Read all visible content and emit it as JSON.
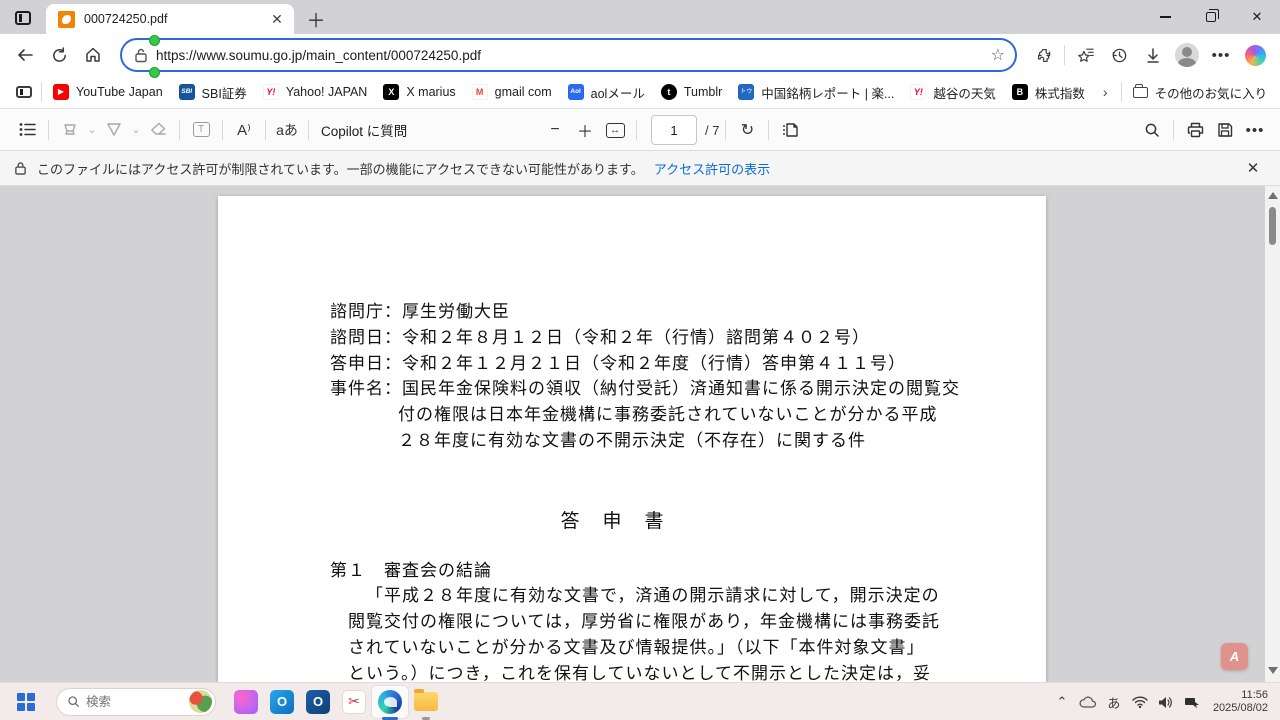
{
  "window": {
    "tab_title": "000724250.pdf"
  },
  "icons": {
    "close": "✕",
    "plus": "＋",
    "minus": "−",
    "back": "←",
    "star": "☆",
    "more_dots": "•••",
    "ellipsis": "…",
    "chevron_down": "⌄",
    "chevron_right": "›",
    "caret_up": "⌃",
    "fit_arrows": "↔",
    "rotate": "↻",
    "read_aloud": "A⁾",
    "translate": "aあ",
    "text_box": "T",
    "ime_mode": "あ",
    "play": "▶",
    "scissors": "✂",
    "acrobat": "A",
    "outlook_o": "O"
  },
  "address_bar": {
    "url": "https://www.soumu.go.jp/main_content/000724250.pdf"
  },
  "bookmarks": {
    "items": [
      {
        "label": "YouTube Japan",
        "glyph": "▶",
        "icon_style": "background:#f00;color:#fff;font-size:8px"
      },
      {
        "label": "SBI証券",
        "glyph": "SBI",
        "icon_style": "background:#16549c;color:#fff;font-size:6.5px;font-style:italic;font-weight:bold"
      },
      {
        "label": "Yahoo! JAPAN",
        "glyph": "Y!",
        "icon_style": "background:#fff;color:#f03;font-weight:bold;font-style:italic"
      },
      {
        "label": "X marius",
        "glyph": "X",
        "icon_style": "background:#000;color:#fff;font-weight:bold"
      },
      {
        "label": "gmail com",
        "glyph": "M",
        "icon_style": "background:#fff;color:#ea4335;font-weight:bold"
      },
      {
        "label": "aolメール",
        "glyph": "Aol",
        "icon_style": "background:#2b6bf3;color:#fff;font-size:6.5px;font-weight:bold"
      },
      {
        "label": "Tumblr",
        "glyph": "t",
        "icon_style": "background:#000;color:#fff;font-weight:bold;border-radius:50%"
      },
      {
        "label": "中国銘柄レポート | 楽...",
        "glyph": "トウ",
        "icon_style": "background:#2567c6;color:#fff;font-size:6px"
      },
      {
        "label": "越谷の天気",
        "glyph": "Y!",
        "icon_style": "background:#fff;color:#f03;font-weight:bold;font-style:italic"
      },
      {
        "label": "株式指数",
        "glyph": "B",
        "icon_style": "background:#000;color:#fff;font-weight:bold"
      }
    ],
    "other_favorites": "その他のお気に入り"
  },
  "pdf_toolbar": {
    "copilot_label": "Copilot に質問",
    "page_current": "1",
    "page_total": "/ 7"
  },
  "notice": {
    "text": "このファイルにはアクセス許可が制限されています。一部の機能にアクセスできない可能性があります。",
    "link": "アクセス許可の表示"
  },
  "document": {
    "lines": [
      "諮問庁：厚生労働大臣",
      "諮問日：令和２年８月１２日（令和２年（行情）諮問第４０２号）",
      "答申日：令和２年１２月２１日（令和２年度（行情）答申第４１１号）",
      "事件名：国民年金保険料の領収（納付受託）済通知書に係る開示決定の閲覧交",
      "付の権限は日本年金機構に事務委託されていないことが分かる平成",
      "２８年度に有効な文書の不開示決定（不存在）に関する件"
    ],
    "title": "答　申　書",
    "section_heading": "第１　審査会の結論",
    "body_lines": [
      "「平成２８年度に有効な文書で，済通の開示請求に対して，開示決定の",
      "閲覧交付の権限については，厚労省に権限があり，年金機構には事務委託",
      "されていないことが分かる文書及び情報提供。」（以下「本件対象文書」",
      "という。）につき，これを保有していないとして不開示とした決定は，妥"
    ]
  },
  "taskbar": {
    "search_placeholder": "検索",
    "time": "11:56",
    "date": "2025/08/02"
  },
  "colors": {
    "accent_blue": "#2b6bd9",
    "link_blue": "#0b6cd4",
    "taskbar_bg": "#f3ebe9",
    "pdf_bg": "#d2d2d4"
  }
}
